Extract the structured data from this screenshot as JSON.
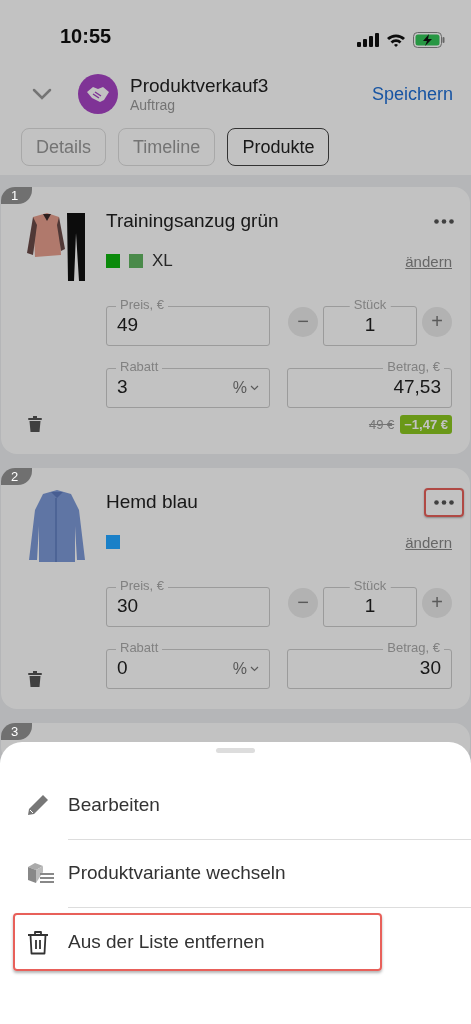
{
  "status_bar": {
    "time": "10:55"
  },
  "header": {
    "title": "Produktverkauf3",
    "subtitle": "Auftrag",
    "save": "Speichern"
  },
  "tabs": [
    {
      "label": "Details",
      "selected": false
    },
    {
      "label": "Timeline",
      "selected": false
    },
    {
      "label": "Produkte",
      "selected": true
    }
  ],
  "products": [
    {
      "number": "1",
      "name": "Trainingsanzug grün",
      "swatches": [
        {
          "color": "#0b8a0b"
        },
        {
          "color": "#4a8a4a"
        }
      ],
      "size": "XL",
      "change": "ändern",
      "more_highlighted": false,
      "price_label": "Preis, €",
      "price": "49",
      "minus": "−",
      "qty_label": "Stück",
      "qty": "1",
      "plus": "+",
      "discount_label": "Rabatt",
      "discount": "3",
      "discount_unit": "%",
      "amount_label": "Betrag, €",
      "amount": "47,53",
      "old_price": "49 €",
      "saving": "−1,47 €"
    },
    {
      "number": "2",
      "name": "Hemd blau",
      "swatches": [
        {
          "color": "#1a80c8"
        }
      ],
      "change": "ändern",
      "more_highlighted": true,
      "price_label": "Preis, €",
      "price": "30",
      "minus": "−",
      "qty_label": "Stück",
      "qty": "1",
      "plus": "+",
      "discount_label": "Rabatt",
      "discount": "0",
      "discount_unit": "%",
      "amount_label": "Betrag, €",
      "amount": "30"
    }
  ],
  "partial_card": {
    "number": "3"
  },
  "sheet": {
    "items": [
      {
        "kind": "edit",
        "label": "Bearbeiten",
        "highlighted": false
      },
      {
        "kind": "variant",
        "label": "Produktvariante wechseln",
        "highlighted": false
      },
      {
        "kind": "remove",
        "label": "Aus der Liste entfernen",
        "highlighted": true
      }
    ]
  }
}
